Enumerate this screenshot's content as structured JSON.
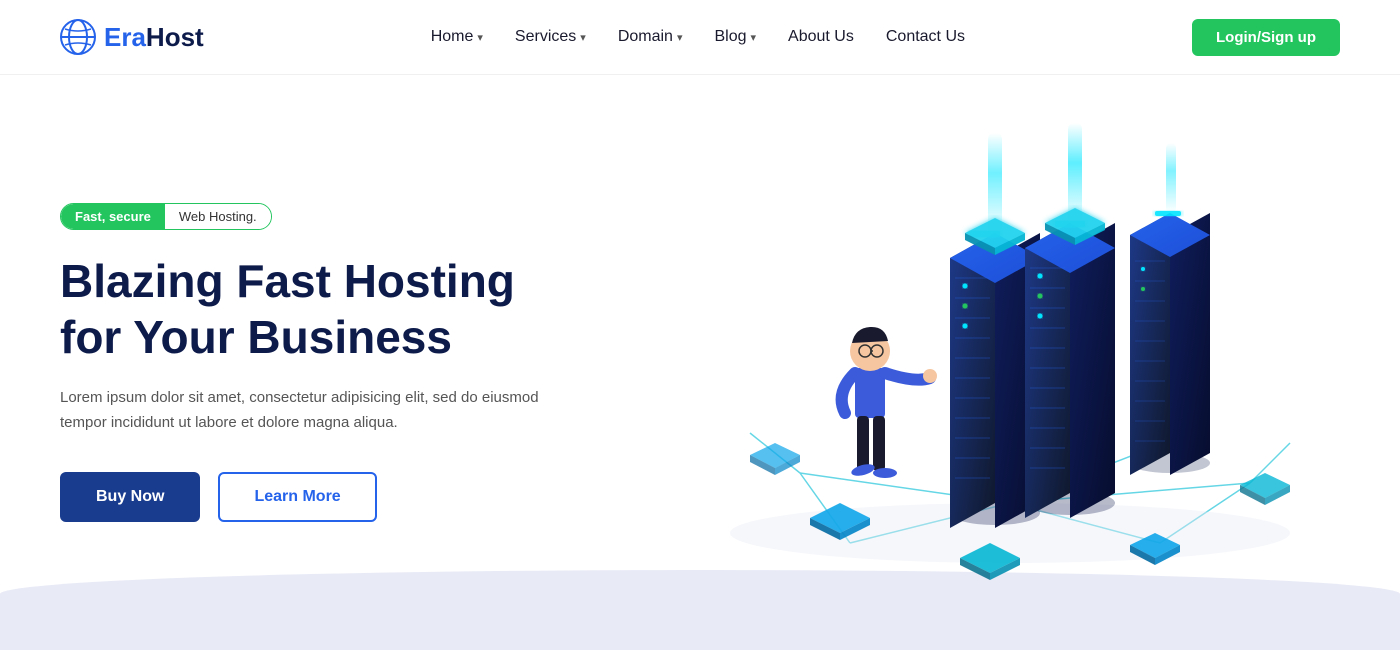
{
  "brand": {
    "name_prefix": "Era",
    "name_suffix": "Host",
    "logo_icon": "globe"
  },
  "nav": {
    "links": [
      {
        "label": "Home",
        "has_dropdown": true
      },
      {
        "label": "Services",
        "has_dropdown": true
      },
      {
        "label": "Domain",
        "has_dropdown": true
      },
      {
        "label": "Blog",
        "has_dropdown": true
      },
      {
        "label": "About Us",
        "has_dropdown": false
      },
      {
        "label": "Contact Us",
        "has_dropdown": false
      }
    ],
    "cta_label": "Login/Sign up"
  },
  "hero": {
    "badge_highlight": "Fast, secure",
    "badge_text": "Web Hosting.",
    "title_line1": "Blazing Fast Hosting",
    "title_line2": "for Your Business",
    "description": "Lorem ipsum dolor sit amet, consectetur adipisicing elit, sed do eiusmod tempor incididunt ut labore et dolore magna aliqua.",
    "btn_primary": "Buy Now",
    "btn_secondary": "Learn More"
  }
}
